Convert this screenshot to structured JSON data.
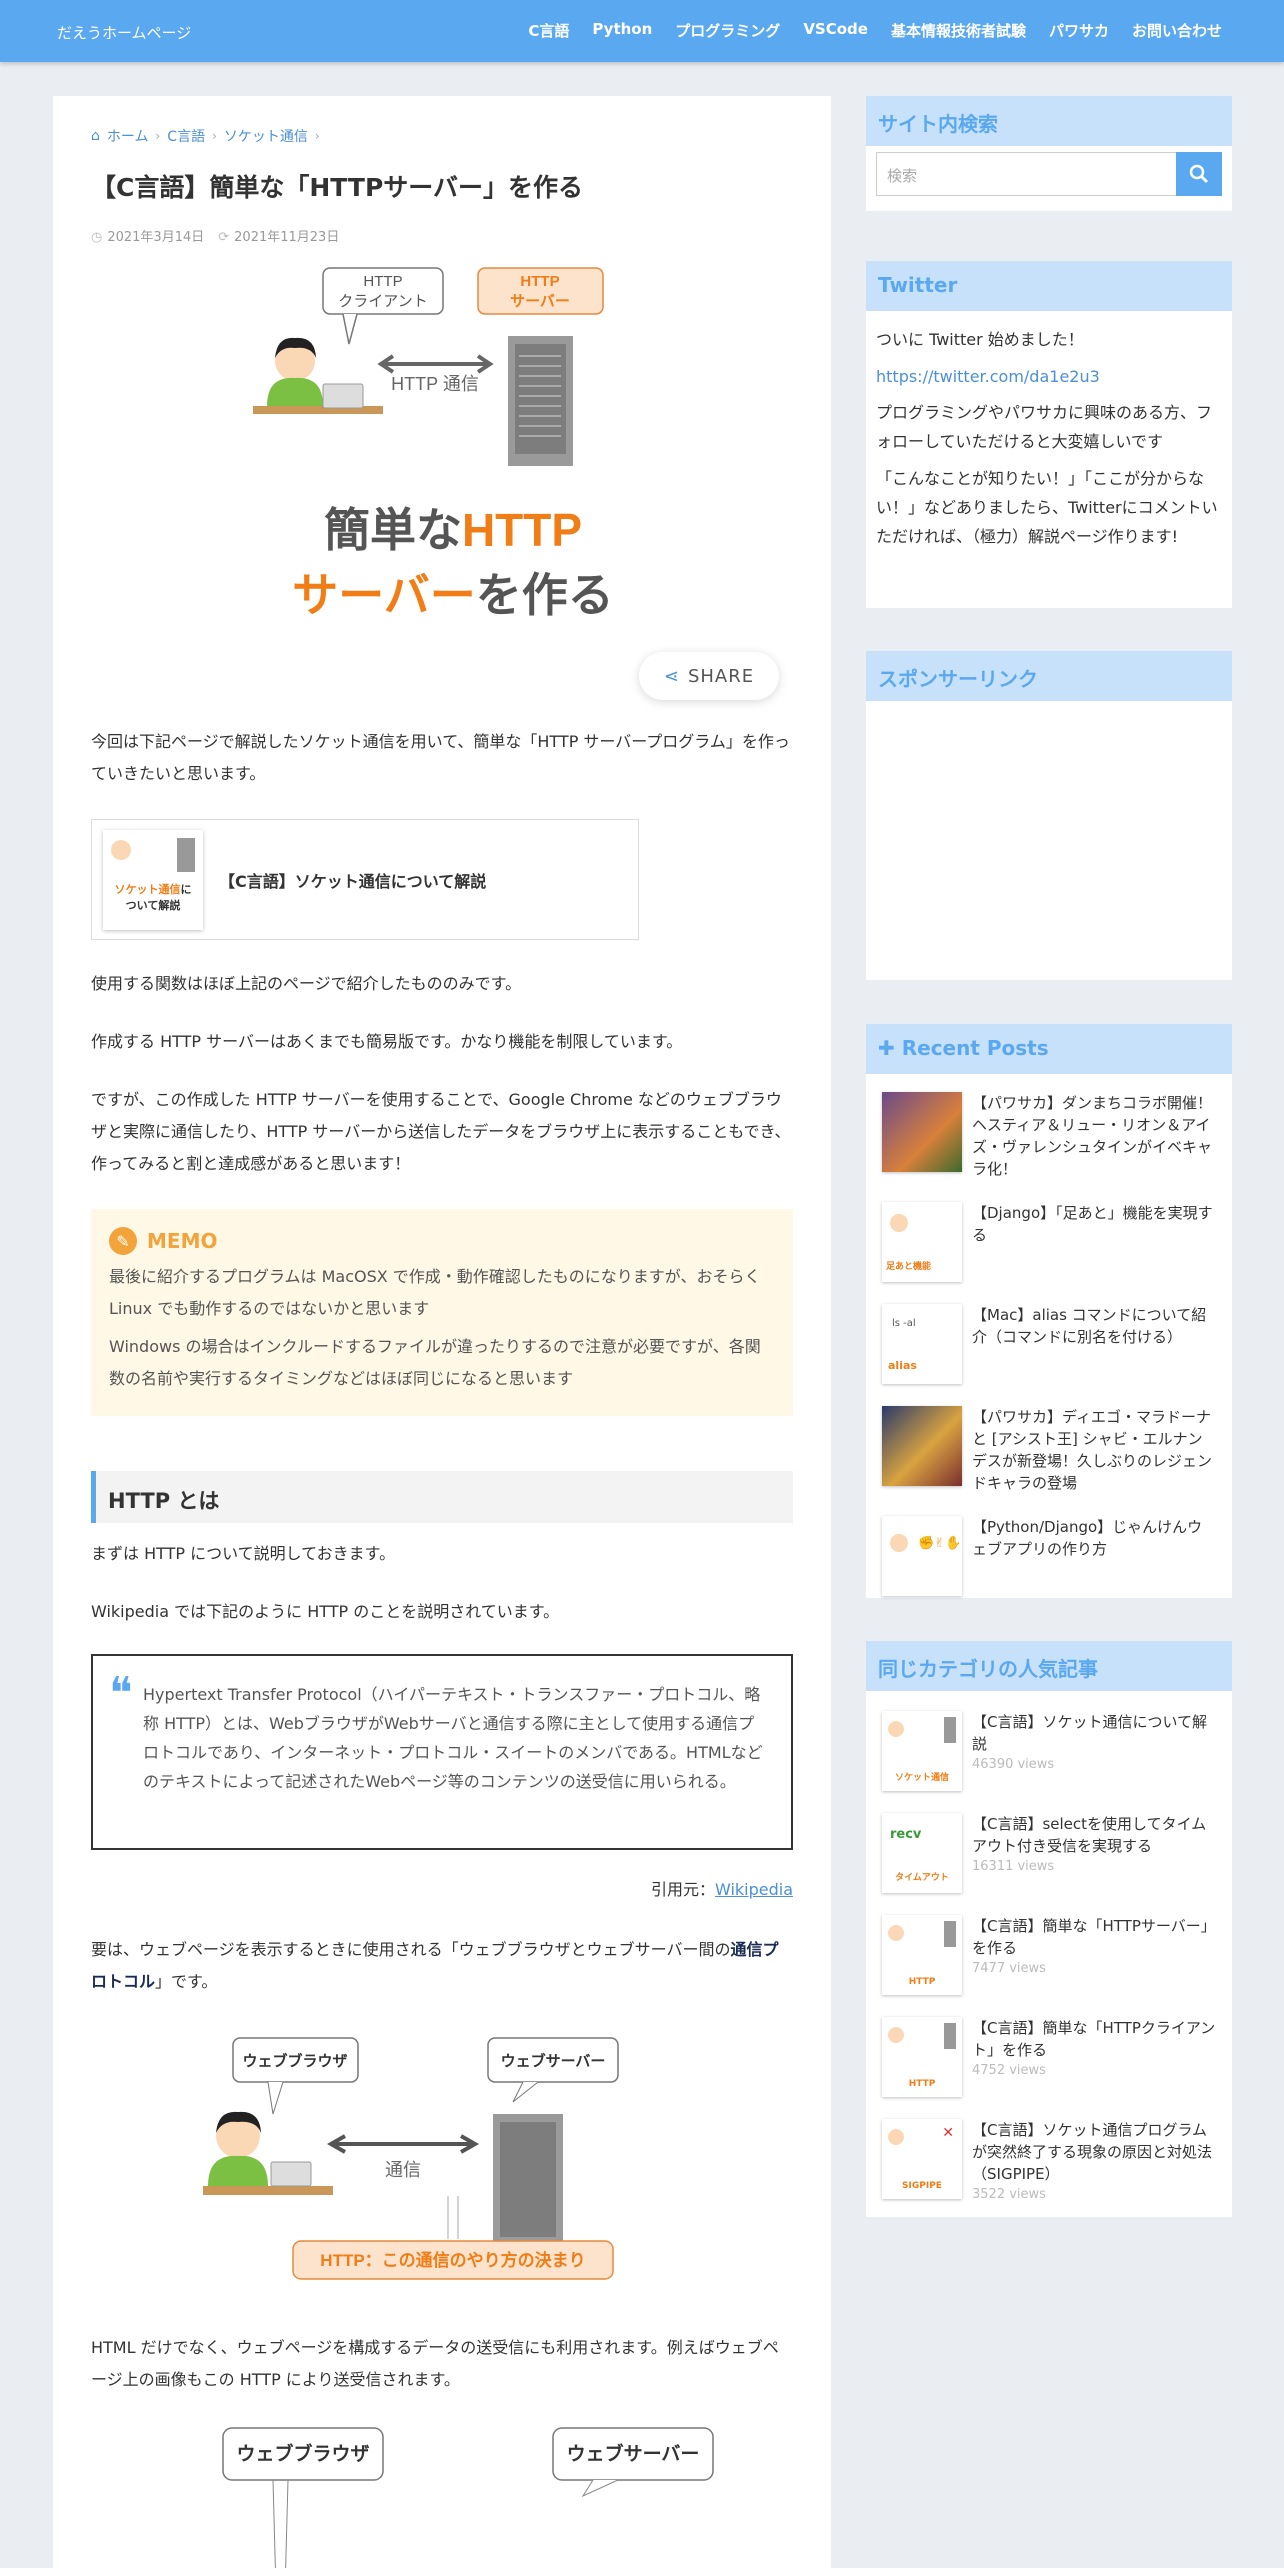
{
  "header": {
    "site_title": "だえうホームページ",
    "nav": [
      "C言語",
      "Python",
      "プログラミング",
      "VSCode",
      "基本情報技術者試験",
      "パワサカ",
      "お問い合わせ"
    ]
  },
  "article": {
    "breadcrumb": [
      "ホーム",
      "C言語",
      "ソケット通信"
    ],
    "title": "【C言語】簡単な「HTTPサーバー」を作る",
    "published": "2021年3月14日",
    "updated": "2021年11月23日",
    "eyecatch": {
      "client_label_1": "HTTP",
      "client_label_2": "クライアント",
      "server_label_1": "HTTP",
      "server_label_2": "サーバー",
      "arrow_label": "HTTP 通信",
      "title_1a": "簡単な",
      "title_1b": "HTTP",
      "title_2a": "サーバー",
      "title_2b": "を作る"
    },
    "share_label": "SHARE",
    "intro": "今回は下記ページで解説したソケット通信を用いて、簡単な「HTTP サーバープログラム」を作っていきたいと思います。",
    "card_title": "【C言語】ソケット通信について解説",
    "card_thumb_1": "ソケット通信",
    "card_thumb_2": "に",
    "card_thumb_3": "ついて解説",
    "p1": "使用する関数はほぼ上記のページで紹介したもののみです。",
    "p2": "作成する HTTP サーバーはあくまでも簡易版です。かなり機能を制限しています。",
    "p3": "ですが、この作成した HTTP サーバーを使用することで、Google Chrome などのウェブブラウザと実際に通信したり、HTTP サーバーから送信したデータをブラウザ上に表示することもでき、作ってみると割と達成感があると思います！",
    "memo": {
      "label": "MEMO",
      "line1": "最後に紹介するプログラムは MacOSX で作成・動作確認したものになりますが、おそらく Linux でも動作するのではないかと思います",
      "line2": "Windows の場合はインクルードするファイルが違ったりするので注意が必要ですが、各関数の名前や実行するタイミングなどはほぼ同じになると思います"
    },
    "h2": "HTTP とは",
    "p4": "まずは HTTP について説明しておきます。",
    "p5": "Wikipedia では下記のように HTTP のことを説明されています。",
    "quote": "Hypertext Transfer Protocol（ハイパーテキスト・トランスファー・プロトコル、略称 HTTP）とは、WebブラウザがWebサーバと通信する際に主として使用する通信プロトコルであり、インターネット・プロトコル・スイートのメンバである。HTMLなどのテキストによって記述されたWebページ等のコンテンツの送受信に用いられる。",
    "cite_prefix": "引用元：",
    "cite_link": "Wikipedia",
    "p6a": "要は、ウェブページを表示するときに使用される「ウェブブラウザとウェブサーバー間の",
    "p6b": "通信プロトコル",
    "p6c": "」です。",
    "fig1": {
      "browser": "ウェブブラウザ",
      "server": "ウェブサーバー",
      "arrow": "通信",
      "caption": "HTTP：この通信のやり方の決まり"
    },
    "p7": "HTML だけでなく、ウェブページを構成するデータの送受信にも利用されます。例えばウェブページ上の画像もこの HTTP により送受信されます。",
    "fig2": {
      "browser": "ウェブブラウザ",
      "server": "ウェブサーバー"
    }
  },
  "sidebar": {
    "search": {
      "heading": "サイト内検索",
      "placeholder": "検索"
    },
    "twitter": {
      "heading": "Twitter",
      "line1": "ついに Twitter 始めました！",
      "link": "https://twitter.com/da1e2u3",
      "line2": "プログラミングやパワサカに興味のある方、フォローしていただけると大変嬉しいです",
      "line3": "「こんなことが知りたい！」「ここが分からない！」などありましたら、Twitterにコメントいただければ、（極力）解説ページ作ります!"
    },
    "sponsor": {
      "heading": "スポンサーリンク"
    },
    "recent": {
      "heading": "Recent Posts",
      "items": [
        "【パワサカ】ダンまちコラボ開催！ヘスティア＆リュー・リオン＆アイズ・ヴァレンシュタインがイベキャラ化！",
        "【Django】「足あと」機能を実現する",
        "【Mac】alias コマンドについて紹介（コマンドに別名を付ける）",
        "【パワサカ】ディエゴ・マラドーナと [アシスト王] シャビ・エルナンデスが新登場！久しぶりのレジェンドキャラの登場",
        "【Python/Django】じゃんけんウェブアプリの作り方"
      ]
    },
    "popular": {
      "heading": "同じカテゴリの人気記事",
      "items": [
        {
          "title": "【C言語】ソケット通信について解説",
          "views": "46390 views"
        },
        {
          "title": "【C言語】selectを使用してタイムアウト付き受信を実現する",
          "views": "16311 views"
        },
        {
          "title": "【C言語】簡単な「HTTPサーバー」を作る",
          "views": "7477 views"
        },
        {
          "title": "【C言語】簡単な「HTTPクライアント」を作る",
          "views": "4752 views"
        },
        {
          "title": "【C言語】ソケット通信プログラムが突然終了する現象の原因と対処法（SIGPIPE）",
          "views": "3522 views"
        }
      ]
    }
  },
  "colors": {
    "accent": "#5aa8f0",
    "orange": "#f07d16",
    "memo": "#f2a43a"
  }
}
